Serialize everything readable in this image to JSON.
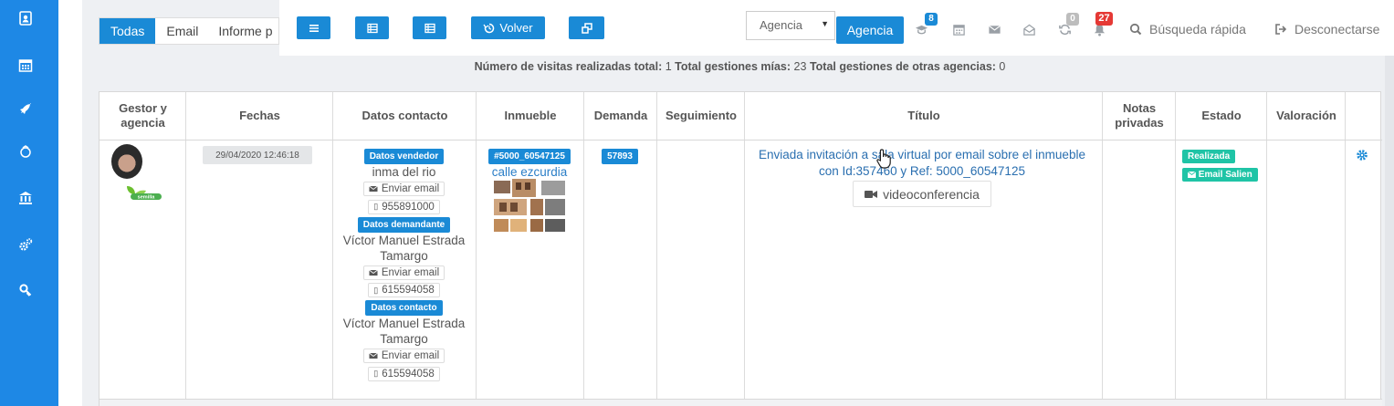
{
  "tabs": [
    "Todas",
    "Email",
    "Informe p"
  ],
  "toolbar": {
    "volver_label": "Volver",
    "agency_select_value": "Agencia",
    "agency_button_label": "Agencia",
    "badges": {
      "notifications": "8",
      "sync": "0",
      "alerts": "27"
    },
    "search_label": "Búsqueda rápida",
    "logout_label": "Desconectarse"
  },
  "summary": {
    "visits_label": "Número de visitas realizadas total:",
    "visits_value": "1",
    "own_label": "Total gestiones mías:",
    "own_value": "23",
    "other_label": "Total gestiones de otras agencias:",
    "other_value": "0"
  },
  "table": {
    "headers": {
      "gestor": "Gestor y agencia",
      "fechas": "Fechas",
      "datos": "Datos contacto",
      "inmueble": "Inmueble",
      "demanda": "Demanda",
      "seguimiento": "Seguimiento",
      "titulo": "Título",
      "notas": "Notas privadas",
      "estado": "Estado",
      "valoracion": "Valoración"
    },
    "row": {
      "agency_logo_text": "semilla",
      "fecha": "29/04/2020 12:46:18",
      "vendedor_label": "Datos vendedor",
      "vendedor_name": "inma del rio",
      "email_btn": "Enviar email",
      "vendedor_phone": "955891000",
      "demandante_label": "Datos demandante",
      "demandante_name": "Víctor Manuel Estrada Tamargo",
      "demandante_phone": "615594058",
      "contacto_label": "Datos contacto",
      "contacto_name": "Víctor Manuel Estrada Tamargo",
      "contacto_phone": "615594058",
      "inmueble_ref": "#5000_60547125",
      "inmueble_street": "calle ezcurdia",
      "demanda": "57893",
      "titulo_line1": "Enviada invitación a sala virtual por email sobre el inmueble",
      "titulo_line2": "con Id:357460 y Ref: 5000_60547125",
      "video_btn": "videoconferencia",
      "estado_realizada": "Realizada",
      "estado_email": "Email Salien"
    }
  },
  "colors": {
    "sidebar": "#1e88e5",
    "accent": "#1a8ad6",
    "green": "#1fc4a6",
    "badge_red": "#e53935"
  }
}
